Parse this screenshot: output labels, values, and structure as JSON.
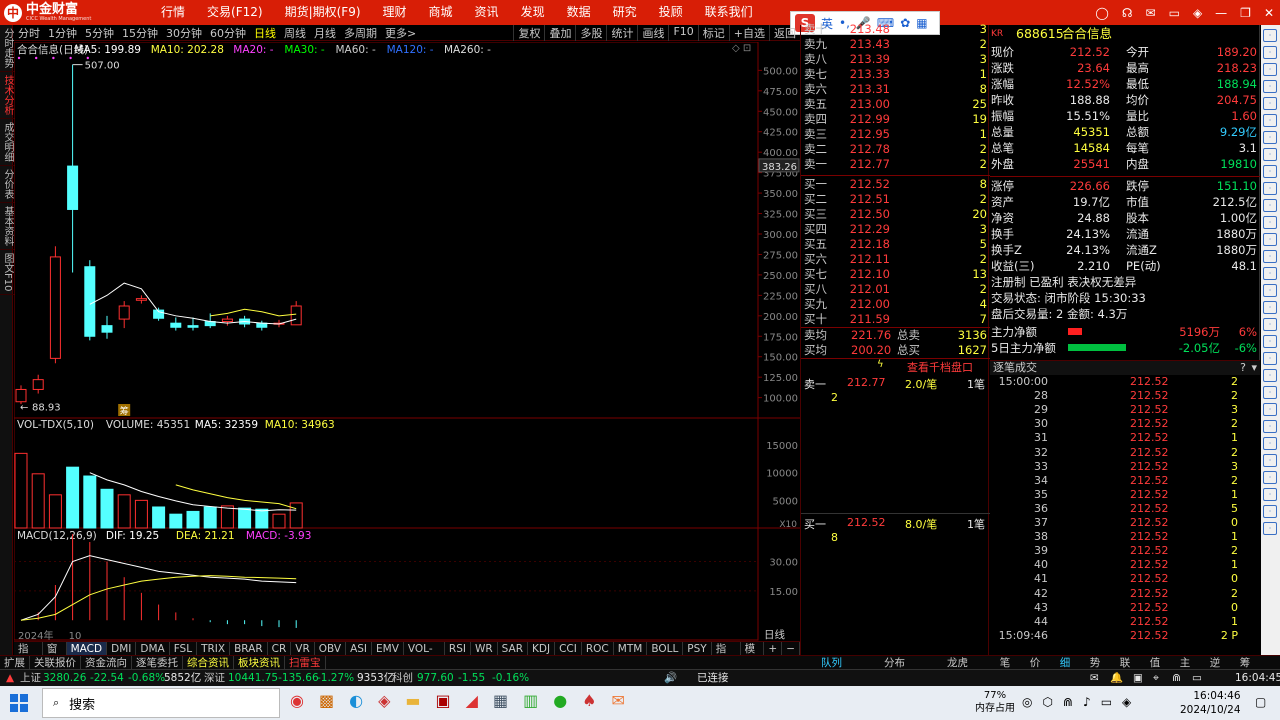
{
  "app": {
    "brand": "中金财富",
    "brand_sub": "CICC Wealth Management"
  },
  "menu": [
    "行情",
    "交易(F12)",
    "期货|期权(F9)",
    "理财",
    "商城",
    "资讯",
    "发现",
    "数据",
    "研究",
    "投顾",
    "联系我们"
  ],
  "ime": {
    "mode": "英"
  },
  "left_tabs": [
    "分时走势",
    "技术分析",
    "成交明细",
    "分价表",
    "基本资料",
    "图文F10"
  ],
  "periods": [
    "分时",
    "1分钟",
    "5分钟",
    "15分钟",
    "30分钟",
    "60分钟",
    "日线",
    "周线",
    "月线",
    "多周期",
    "更多>"
  ],
  "period_active": "日线",
  "chart_tools": [
    "复权",
    "叠加",
    "多股",
    "统计",
    "画线",
    "F10",
    "标记",
    "+自选",
    "返回"
  ],
  "main_legend": {
    "name": "合合信息(日线)",
    "ma5": "MA5: 199.89",
    "ma10": "MA10: 202.28",
    "ma20": "MA20: -",
    "ma30": "MA30: -",
    "ma60": "MA60: -",
    "ma120": "MA120: -",
    "ma250": "MA260: -"
  },
  "price_labels": {
    "high": "507.00",
    "low": "88.93",
    "cursor": "383.26",
    "ipo_mark": "筹"
  },
  "vol_legend": {
    "name": "VOL-TDX(5,10)",
    "volume": "VOLUME: 45351",
    "ma5": "MA5: 32359",
    "ma10": "MA10: 34963",
    "unit": "X10"
  },
  "macd_legend": {
    "name": "MACD(12,26,9)",
    "dif": "DIF: 19.25",
    "dea": "DEA: 21.21",
    "macd": "MACD: -3.93"
  },
  "x_labels": {
    "year": "2024年",
    "month": "10"
  },
  "chart_data": [
    {
      "type": "candlestick",
      "title": "合合信息(日线)",
      "ylim": [
        80,
        520
      ],
      "yticks": [
        500,
        475,
        450,
        425,
        400,
        375,
        350,
        325,
        300,
        275,
        250,
        225,
        200,
        175,
        150,
        125,
        100
      ],
      "candles": [
        {
          "o": 95,
          "c": 110,
          "h": 115,
          "l": 92,
          "up": true
        },
        {
          "o": 110,
          "c": 122,
          "h": 128,
          "l": 105,
          "up": true
        },
        {
          "o": 148,
          "c": 272,
          "h": 285,
          "l": 142,
          "up": true
        },
        {
          "o": 383,
          "c": 330,
          "h": 507,
          "l": 253,
          "up": false
        },
        {
          "o": 260,
          "c": 175,
          "h": 268,
          "l": 170,
          "up": false
        },
        {
          "o": 188,
          "c": 180,
          "h": 200,
          "l": 172,
          "up": false
        },
        {
          "o": 196,
          "c": 212,
          "h": 218,
          "l": 185,
          "up": true
        },
        {
          "o": 219,
          "c": 221,
          "h": 225,
          "l": 215,
          "up": true
        },
        {
          "o": 207,
          "c": 197,
          "h": 210,
          "l": 194,
          "up": false
        },
        {
          "o": 191,
          "c": 186,
          "h": 198,
          "l": 182,
          "up": false
        },
        {
          "o": 188,
          "c": 186,
          "h": 198,
          "l": 182,
          "up": false
        },
        {
          "o": 193,
          "c": 188,
          "h": 203,
          "l": 185,
          "up": false
        },
        {
          "o": 193,
          "c": 196,
          "h": 200,
          "l": 188,
          "up": true
        },
        {
          "o": 196,
          "c": 190,
          "h": 200,
          "l": 186,
          "up": false
        },
        {
          "o": 191,
          "c": 186,
          "h": 194,
          "l": 182,
          "up": false
        },
        {
          "o": 190,
          "c": 191,
          "h": 195,
          "l": 186,
          "up": true
        },
        {
          "o": 189,
          "c": 212,
          "h": 218,
          "l": 189,
          "up": true
        }
      ],
      "ma5": [
        null,
        null,
        null,
        null,
        214,
        225,
        240,
        233,
        205,
        200,
        197,
        193,
        191,
        193,
        191,
        190,
        196
      ],
      "ma10": [
        null,
        null,
        null,
        null,
        null,
        null,
        null,
        null,
        null,
        null,
        null,
        200,
        203,
        208,
        205,
        200,
        202
      ]
    },
    {
      "type": "bar",
      "title": "VOL-TDX(5,10)",
      "ylim": [
        0,
        17000
      ],
      "yticks": [
        15000,
        10000,
        5000
      ],
      "values": [
        13500,
        9800,
        6000,
        11000,
        9400,
        7000,
        6000,
        5000,
        3800,
        2500,
        3000,
        3800,
        4000,
        3600,
        3400,
        2500,
        4535
      ],
      "up": [
        true,
        true,
        true,
        false,
        false,
        false,
        true,
        true,
        false,
        false,
        false,
        false,
        true,
        false,
        false,
        true,
        true
      ],
      "ma5": [
        null,
        null,
        null,
        null,
        10000,
        8700,
        7800,
        6600,
        5700,
        4900,
        4200,
        3900,
        3600,
        3400,
        3100,
        3300,
        3236
      ],
      "ma10": [
        null,
        null,
        null,
        null,
        null,
        null,
        null,
        null,
        null,
        7800,
        6900,
        6200,
        5500,
        5000,
        4700,
        4400,
        3496
      ]
    },
    {
      "type": "line",
      "title": "MACD(12,26,9)",
      "ylim": [
        -5,
        40
      ],
      "yticks": [
        30,
        15
      ],
      "dif": [
        0,
        3,
        12,
        30,
        33,
        31,
        29,
        27,
        25,
        24,
        23,
        22,
        21.5,
        21,
        20,
        19.6,
        19.25
      ],
      "dea": [
        0,
        1,
        3,
        8,
        13,
        16,
        18,
        20,
        21,
        22,
        22.5,
        22.8,
        22.5,
        22,
        21.8,
        21.5,
        21.21
      ],
      "macd": [
        0,
        4,
        18,
        44,
        40,
        30,
        22,
        14,
        8,
        4,
        1,
        -1,
        -2,
        -2,
        -3,
        -3.5,
        -3.93
      ]
    }
  ],
  "indicator_tabs": [
    "指标A",
    "窗口",
    "MACD",
    "DMI",
    "DMA",
    "FSL",
    "TRIX",
    "BRAR",
    "CR",
    "VR",
    "OBV",
    "ASI",
    "EMV",
    "VOL-TDX",
    "RSI",
    "WR",
    "SAR",
    "KDJ",
    "CCI",
    "ROC",
    "MTM",
    "BOLL",
    "PSY",
    "指标B",
    "模板"
  ],
  "indicator_active": "MACD",
  "bottom_tabs": [
    "扩展",
    "关联报价",
    "资金流向",
    "逐笔委托",
    "综合资讯",
    "板块资讯",
    "扫雷宝"
  ],
  "order_book": {
    "sells": [
      [
        "卖十",
        "213.48",
        "3"
      ],
      [
        "卖九",
        "213.43",
        "2"
      ],
      [
        "卖八",
        "213.39",
        "3"
      ],
      [
        "卖七",
        "213.33",
        "1"
      ],
      [
        "卖六",
        "213.31",
        "8"
      ],
      [
        "卖五",
        "213.00",
        "25"
      ],
      [
        "卖四",
        "212.99",
        "19"
      ],
      [
        "卖三",
        "212.95",
        "1"
      ],
      [
        "卖二",
        "212.78",
        "2"
      ],
      [
        "卖一",
        "212.77",
        "2"
      ]
    ],
    "buys": [
      [
        "买一",
        "212.52",
        "8"
      ],
      [
        "买二",
        "212.51",
        "2"
      ],
      [
        "买三",
        "212.50",
        "20"
      ],
      [
        "买四",
        "212.29",
        "3"
      ],
      [
        "买五",
        "212.18",
        "5"
      ],
      [
        "买六",
        "212.11",
        "2"
      ],
      [
        "买七",
        "212.10",
        "13"
      ],
      [
        "买八",
        "212.01",
        "2"
      ],
      [
        "买九",
        "212.00",
        "4"
      ],
      [
        "买十",
        "211.59",
        "7"
      ]
    ],
    "avg_sell": [
      "卖均",
      "221.76",
      "总卖",
      "3136"
    ],
    "avg_buy": [
      "买均",
      "200.20",
      "总买",
      "1627"
    ],
    "thousand_link": "查看千档盘口",
    "queue_sell": {
      "label": "卖一",
      "price": "212.77",
      "per": "2.0/笔",
      "count": "1笔",
      "item": "2"
    },
    "queue_buy": {
      "label": "买一",
      "price": "212.52",
      "per": "8.0/笔",
      "count": "1笔",
      "item": "8"
    }
  },
  "quote": {
    "code": "688615",
    "name": "合合信息",
    "tag": "KR",
    "rows": [
      [
        "现价",
        "212.52",
        "今开",
        "189.20"
      ],
      [
        "涨跌",
        "23.64",
        "最高",
        "218.23"
      ],
      [
        "涨幅",
        "12.52%",
        "最低",
        "188.94"
      ],
      [
        "昨收",
        "188.88",
        "均价",
        "204.75"
      ],
      [
        "振幅",
        "15.51%",
        "量比",
        "1.60"
      ],
      [
        "总量",
        "45351",
        "总额",
        "9.29亿"
      ],
      [
        "总笔",
        "14584",
        "每笔",
        "3.1"
      ],
      [
        "外盘",
        "25541",
        "内盘",
        "19810"
      ],
      [
        "涨停",
        "226.66",
        "跌停",
        "151.10"
      ],
      [
        "资产",
        "19.7亿",
        "市值",
        "212.5亿"
      ],
      [
        "净资",
        "24.88",
        "股本",
        "1.00亿"
      ],
      [
        "换手",
        "24.13%",
        "流通",
        "1880万"
      ],
      [
        "换手Z",
        "24.13%",
        "流通Z",
        "1880万"
      ],
      [
        "收益(三)",
        "2.210",
        "PE(动)",
        "48.1"
      ]
    ],
    "reg": "注册制 已盈利 表决权无差异",
    "trade_state": "交易状态: 闭市阶段 15:30:33",
    "after_hours": "盘后交易量: 2  金额: 4.3万",
    "main_flow": [
      "主力净额",
      "5196万",
      "6%"
    ],
    "flow5": [
      "5日主力净额",
      "-2.05亿",
      "-6%"
    ]
  },
  "ticks": {
    "title": "逐笔成交",
    "rows": [
      [
        "15:00:00",
        "212.52",
        "2"
      ],
      [
        "28",
        "212.52",
        "2"
      ],
      [
        "29",
        "212.52",
        "3"
      ],
      [
        "30",
        "212.52",
        "2"
      ],
      [
        "31",
        "212.52",
        "1"
      ],
      [
        "32",
        "212.52",
        "2"
      ],
      [
        "33",
        "212.52",
        "3"
      ],
      [
        "34",
        "212.52",
        "2"
      ],
      [
        "35",
        "212.52",
        "1"
      ],
      [
        "36",
        "212.52",
        "5"
      ],
      [
        "37",
        "212.52",
        "0"
      ],
      [
        "38",
        "212.52",
        "1"
      ],
      [
        "39",
        "212.52",
        "2"
      ],
      [
        "40",
        "212.52",
        "1"
      ],
      [
        "41",
        "212.52",
        "0"
      ],
      [
        "42",
        "212.52",
        "2"
      ],
      [
        "43",
        "212.52",
        "0"
      ],
      [
        "44",
        "212.52",
        "1"
      ],
      [
        "15:09:46",
        "212.52",
        "2 P"
      ]
    ]
  },
  "right_bottom": [
    "笔",
    "价",
    "细",
    "势",
    "联",
    "值",
    "主",
    "逆",
    "筹"
  ],
  "ob_bottom": [
    "队列",
    "分布",
    "龙虎"
  ],
  "ticker": {
    "sh": "上证",
    "sh_v": "3280.26",
    "sh_c": "-22.54",
    "sh_p": "-0.68%",
    "sh_a": "5852亿",
    "sz": "深证",
    "sz_v": "10441.75-135.66",
    "sz_p": "-1.27%",
    "sz_a": "9353亿",
    "kc": "科创",
    "kc_v": "977.60",
    "kc_c": "-1.55",
    "kc_p": "-0.16%",
    "conn": "已连接",
    "time": "16:04:45"
  },
  "taskbar": {
    "search": "搜索",
    "mem": "77%",
    "mem_label": "内存占用",
    "time": "16:04:46",
    "date": "2024/10/24"
  }
}
